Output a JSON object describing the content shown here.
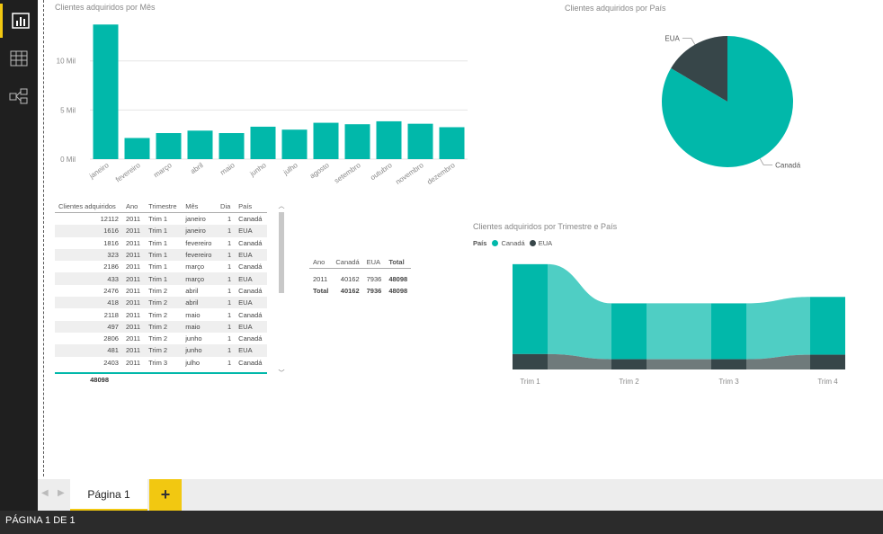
{
  "page": {
    "tab_label": "Página 1",
    "status": "PÁGINA 1 DE 1"
  },
  "colors": {
    "canada": "#01b8aa",
    "eua": "#374649",
    "accent": "#f2c811"
  },
  "left_rail": [
    {
      "icon": "report-icon",
      "active": true
    },
    {
      "icon": "data-icon",
      "active": false
    },
    {
      "icon": "relationships-icon",
      "active": false
    }
  ],
  "chart_data": [
    {
      "type": "bar",
      "title": "Clientes adquiridos por Mês",
      "categories": [
        "janeiro",
        "fevereiro",
        "março",
        "abril",
        "maio",
        "junho",
        "julho",
        "agosto",
        "setembro",
        "outubro",
        "novembro",
        "dezembro"
      ],
      "values": [
        13700,
        2150,
        2650,
        2900,
        2650,
        3300,
        3000,
        3700,
        3550,
        3850,
        3600,
        3250
      ],
      "y_ticks": [
        "0 Mil",
        "5 Mil",
        "10 Mil"
      ],
      "ylim": [
        0,
        14000
      ],
      "grid": true
    },
    {
      "type": "pie",
      "title": "Clientes adquiridos por País",
      "slices": [
        {
          "label": "Canadá",
          "value": 40162
        },
        {
          "label": "EUA",
          "value": 7936
        }
      ]
    },
    {
      "type": "area",
      "title": "Clientes adquiridos por Trimestre e País",
      "legend_title": "País",
      "legend_position": "top-left",
      "categories": [
        "Trim 1",
        "Trim 2",
        "Trim 3",
        "Trim 4"
      ],
      "series": [
        {
          "name": "Canadá",
          "values": [
            14000,
            8700,
            8700,
            9000
          ]
        },
        {
          "name": "EUA",
          "values": [
            2400,
            1600,
            1600,
            2300
          ]
        }
      ]
    }
  ],
  "table": {
    "columns": [
      "Clientes adquiridos",
      "Ano",
      "Trimestre",
      "Mês",
      "Dia",
      "País"
    ],
    "rows": [
      [
        "12112",
        "2011",
        "Trim 1",
        "janeiro",
        "1",
        "Canadá"
      ],
      [
        "1616",
        "2011",
        "Trim 1",
        "janeiro",
        "1",
        "EUA"
      ],
      [
        "1816",
        "2011",
        "Trim 1",
        "fevereiro",
        "1",
        "Canadá"
      ],
      [
        "323",
        "2011",
        "Trim 1",
        "fevereiro",
        "1",
        "EUA"
      ],
      [
        "2186",
        "2011",
        "Trim 1",
        "março",
        "1",
        "Canadá"
      ],
      [
        "433",
        "2011",
        "Trim 1",
        "março",
        "1",
        "EUA"
      ],
      [
        "2476",
        "2011",
        "Trim 2",
        "abril",
        "1",
        "Canadá"
      ],
      [
        "418",
        "2011",
        "Trim 2",
        "abril",
        "1",
        "EUA"
      ],
      [
        "2118",
        "2011",
        "Trim 2",
        "maio",
        "1",
        "Canadá"
      ],
      [
        "497",
        "2011",
        "Trim 2",
        "maio",
        "1",
        "EUA"
      ],
      [
        "2806",
        "2011",
        "Trim 2",
        "junho",
        "1",
        "Canadá"
      ],
      [
        "481",
        "2011",
        "Trim 2",
        "junho",
        "1",
        "EUA"
      ],
      [
        "2403",
        "2011",
        "Trim 3",
        "julho",
        "1",
        "Canadá"
      ]
    ],
    "total": "48098"
  },
  "matrix": {
    "columns": [
      "Ano",
      "Canadá",
      "EUA",
      "Total"
    ],
    "rows": [
      [
        "2011",
        "40162",
        "7936",
        "48098"
      ],
      [
        "Total",
        "40162",
        "7936",
        "48098"
      ]
    ]
  }
}
